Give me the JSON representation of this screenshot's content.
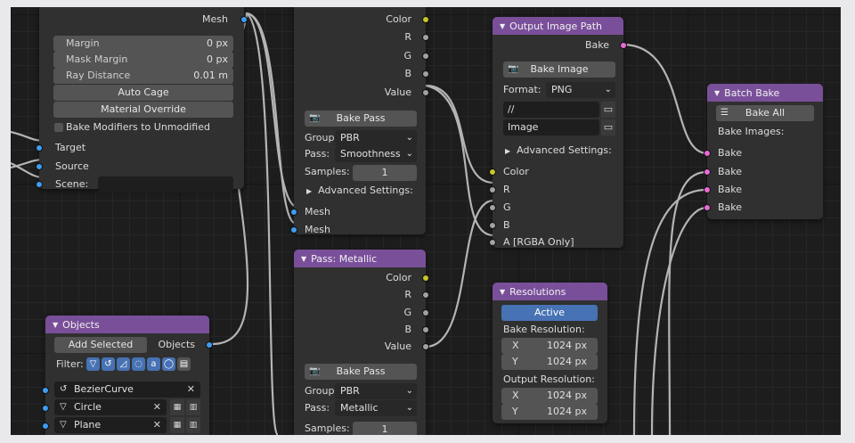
{
  "bake_node_left": {
    "mesh_output": "Mesh",
    "margin_label": "Margin",
    "margin_value": "0 px",
    "mask_margin_label": "Mask Margin",
    "mask_margin_value": "0 px",
    "ray_distance_label": "Ray Distance",
    "ray_distance_value": "0.01 m",
    "auto_cage_label": "Auto Cage",
    "material_override_label": "Material Override",
    "bake_modifiers_label": "Bake Modifiers to Unmodified",
    "target_input": "Target",
    "source_input": "Source",
    "scene_input": "Scene:"
  },
  "bake_pass_top": {
    "outputs": [
      "Color",
      "R",
      "G",
      "B",
      "Value"
    ],
    "bake_pass_button": "Bake Pass",
    "group_label": "Group:",
    "group_value": "PBR",
    "pass_label": "Pass:",
    "pass_value": "Smoothness",
    "samples_label": "Samples:",
    "samples_value": "1",
    "advanced_label": "Advanced Settings:",
    "mesh_inputs": [
      "Mesh",
      "Mesh"
    ]
  },
  "output_image_path": {
    "title": "Output Image Path",
    "bake_output": "Bake",
    "bake_image_button": "Bake Image",
    "format_label": "Format:",
    "format_value": "PNG",
    "path_value": "//",
    "name_value": "Image",
    "advanced_label": "Advanced Settings:",
    "inputs": [
      "Color",
      "R",
      "G",
      "B",
      "A [RGBA Only]"
    ]
  },
  "batch_bake": {
    "title": "Batch Bake",
    "bake_all_button": "Bake All",
    "bake_images_label": "Bake Images:",
    "inputs": [
      "Bake",
      "Bake",
      "Bake",
      "Bake"
    ]
  },
  "pass_metallic": {
    "title": "Pass: Metallic",
    "outputs": [
      "Color",
      "R",
      "G",
      "B",
      "Value"
    ],
    "bake_pass_button": "Bake Pass",
    "group_label": "Group:",
    "group_value": "PBR",
    "pass_label": "Pass:",
    "pass_value": "Metallic",
    "samples_label": "Samples:",
    "samples_value": "1"
  },
  "resolutions": {
    "title": "Resolutions",
    "active_button": "Active",
    "bake_resolution_label": "Bake Resolution:",
    "bake_x_label": "X",
    "bake_x_value": "1024 px",
    "bake_y_label": "Y",
    "bake_y_value": "1024 px",
    "output_resolution_label": "Output Resolution:",
    "out_x_label": "X",
    "out_x_value": "1024 px",
    "out_y_label": "Y",
    "out_y_value": "1024 px"
  },
  "objects": {
    "title": "Objects",
    "add_selected_button": "Add Selected",
    "objects_output": "Objects",
    "filter_label": "Filter:",
    "items": [
      "BezierCurve",
      "Circle",
      "Plane"
    ]
  },
  "colors": {
    "header_purple": "#7a4f9a",
    "socket_geometry": "#3f9df2",
    "socket_color": "#c7c729",
    "socket_value": "#a2a2a2",
    "socket_image": "#e86ad8",
    "accent_blue": "#4772b3"
  },
  "icons": [
    "camera-icon",
    "folder-icon",
    "collapse-arrow-icon",
    "dropdown-chevron-icon",
    "curve-icon",
    "mesh-icon",
    "close-icon",
    "filter-icons"
  ]
}
